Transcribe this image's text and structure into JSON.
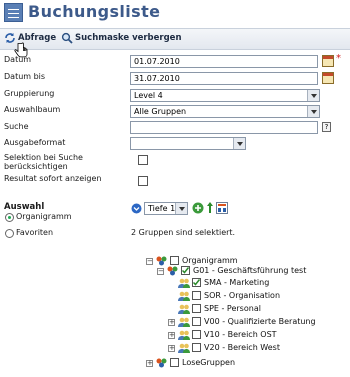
{
  "page": {
    "title": "Buchungsliste"
  },
  "toolbar": {
    "query_label": "Abfrage",
    "hide_label": "Suchmaske verbergen"
  },
  "form": {
    "date_from_label": "Datum",
    "date_from_value": "01.07.2010",
    "date_to_label": "Datum bis",
    "date_to_value": "31.07.2010",
    "grouping_label": "Gruppierung",
    "grouping_value": "Level 4",
    "tree_label": "Auswahlbaum",
    "tree_value": "Alle Gruppen",
    "search_label": "Suche",
    "search_value": "",
    "help_glyph": "?",
    "output_label": "Ausgabeformat",
    "output_value": "",
    "selection_label_1": "Selektion bei Suche",
    "selection_label_2": "berücksichtigen",
    "show_results_label": "Resultat sofort anzeigen",
    "required_mark": "*"
  },
  "selection": {
    "heading": "Auswahl",
    "option_org": "Organigramm",
    "option_fav": "Favoriten",
    "depth_value": "Tiefe 1",
    "selected_info": "2 Gruppen sind selektiert."
  },
  "tree": {
    "root": "Organigramm",
    "g01": "G01 - Geschäftsführung test",
    "sma": "SMA - Marketing",
    "sor": "SOR - Organisation",
    "spe": "SPE - Personal",
    "v00": "V00 - Qualifizierte Beratung",
    "v10": "V10 - Bereich OST",
    "v20": "V20 - Bereich West",
    "lose": "LoseGruppen"
  },
  "colors": {
    "title": "#3d5a8a",
    "toolbar_bg": "#e3e8ef",
    "required": "#d02020",
    "check": "#2a8a2a"
  }
}
